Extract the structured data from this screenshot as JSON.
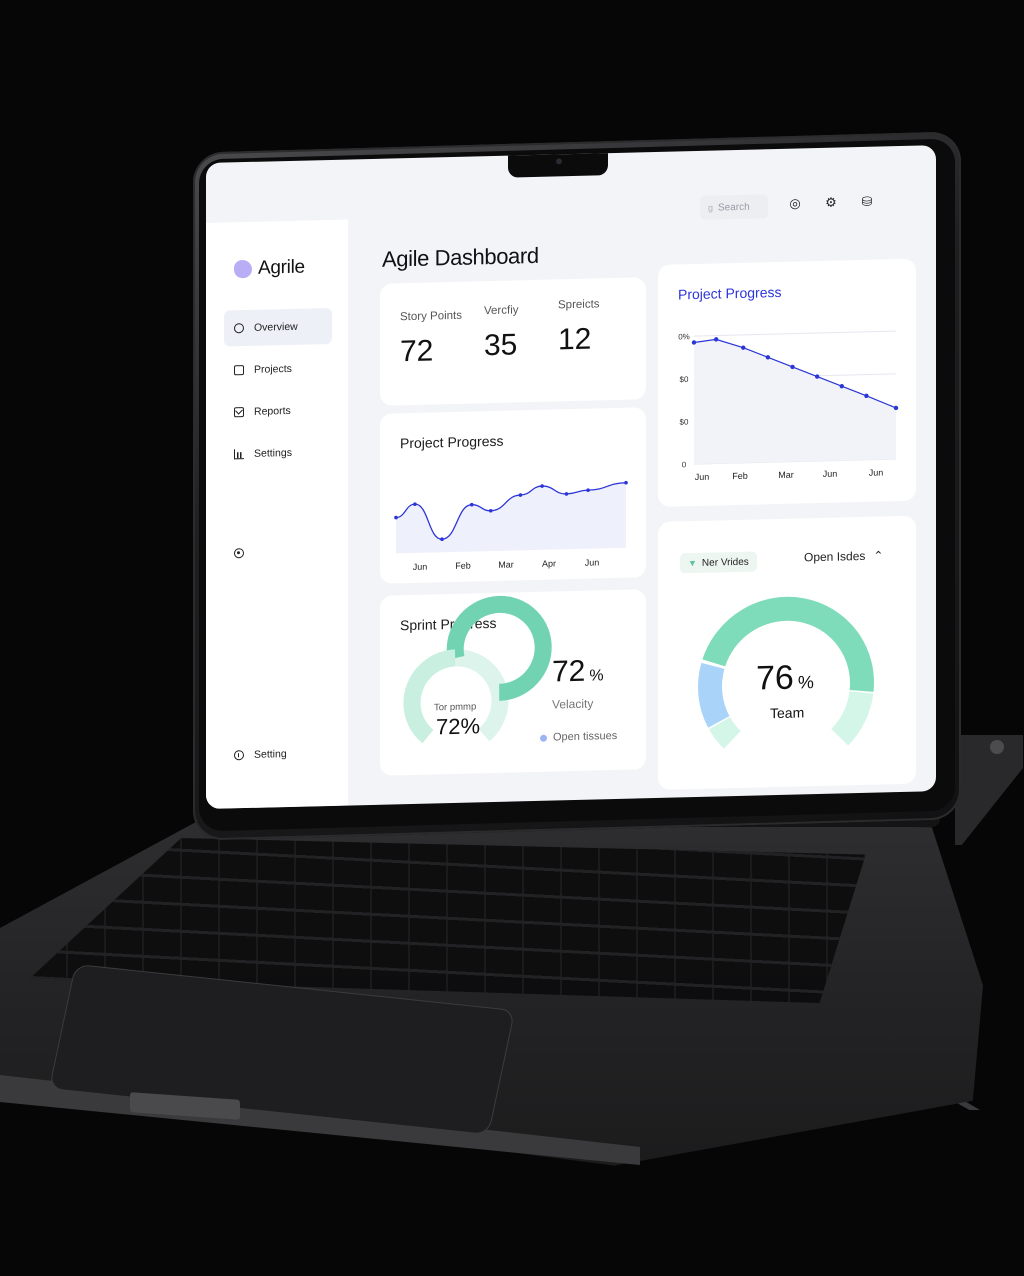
{
  "app": {
    "name": "Agrile"
  },
  "header": {
    "title": "Agile Dashboard",
    "search_placeholder": "Search"
  },
  "sidebar": {
    "items": [
      {
        "label": "Overview",
        "icon": "circle-icon",
        "active": true
      },
      {
        "label": "Projects",
        "icon": "square-icon"
      },
      {
        "label": "Reports",
        "icon": "mail-icon"
      },
      {
        "label": "Settings",
        "icon": "bar-chart-icon"
      }
    ],
    "extra_icon": "target-icon",
    "bottom": {
      "label": "Setting",
      "icon": "info-icon"
    }
  },
  "stats": [
    {
      "label": "Story Points",
      "value": "72"
    },
    {
      "label": "Vercfiy",
      "value": "35"
    },
    {
      "label": "Spreicts",
      "value": "12"
    }
  ],
  "project_progress": {
    "title": "Project Progress",
    "chart_data": {
      "type": "line",
      "x": [
        "Jun",
        "Feb",
        "Mar",
        "Apr",
        "Jun"
      ],
      "tick_positions": [
        0,
        1,
        2,
        3,
        4
      ],
      "series": [
        {
          "values": [
            [
              0,
              0.55
            ],
            [
              0.35,
              0.75
            ],
            [
              0.85,
              0.2
            ],
            [
              1.4,
              0.72
            ],
            [
              1.75,
              0.62
            ],
            [
              2.3,
              0.85
            ],
            [
              2.7,
              0.98
            ],
            [
              3.15,
              0.85
            ],
            [
              3.55,
              0.9
            ],
            [
              4.25,
              1.0
            ]
          ]
        }
      ],
      "ylim": [
        0,
        1.2
      ],
      "color": "#2c35d8"
    }
  },
  "sprint": {
    "title": "Sprint Progress",
    "donut_label": "Tor pmmp",
    "donut_value": "72%",
    "velocity_value": "72",
    "velocity_unit": "%",
    "velocity_label": "Velacity",
    "legend": "Open tissues",
    "progress": 0.72
  },
  "project_progress_right": {
    "title": "Project Progress",
    "chart_data": {
      "type": "line",
      "x": [
        "Jun",
        "Feb",
        "Mar",
        "Jun",
        "Jun"
      ],
      "y_ticks": [
        "0%",
        "$0",
        "$0",
        "0"
      ],
      "series": [
        {
          "values": [
            [
              0,
              95
            ],
            [
              0.45,
              97
            ],
            [
              1.0,
              90
            ],
            [
              1.5,
              82
            ],
            [
              2.0,
              74
            ],
            [
              2.5,
              66
            ],
            [
              3.0,
              58
            ],
            [
              3.5,
              50
            ],
            [
              4.1,
              40
            ]
          ]
        }
      ],
      "ylim": [
        0,
        100
      ],
      "grid": true,
      "color": "#2c35d8"
    }
  },
  "gauge": {
    "pill_label": "Ner Vrides",
    "dropdown_label": "Open Isdes",
    "value": "76",
    "unit": "%",
    "label": "Team",
    "progress": 0.76,
    "colors": {
      "main": "#7fdcbb",
      "secondary": "#a9d3f8",
      "light": "#d4f6e8"
    }
  },
  "colors": {
    "accent": "#2c35d8",
    "teal": "#6fd3b1"
  }
}
